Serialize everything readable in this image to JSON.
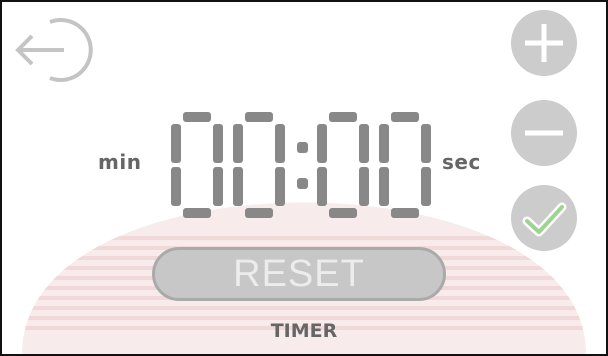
{
  "timer": {
    "display": "00:00",
    "minutes": "00",
    "seconds": "00",
    "min_label": "min",
    "sec_label": "sec"
  },
  "controls": {
    "reset_label": "RESET",
    "mode_label": "TIMER"
  },
  "icons": {
    "back": "exit-arrow-icon",
    "plus": "plus-icon",
    "minus": "minus-icon",
    "confirm": "checkmark-icon"
  },
  "colors": {
    "button_grey": "#cccccc",
    "icon_white": "#ffffff",
    "segment_grey": "#888888",
    "label_grey": "#666666",
    "check_green": "#9cd58f",
    "dome_pink": "#f6e3e3"
  }
}
